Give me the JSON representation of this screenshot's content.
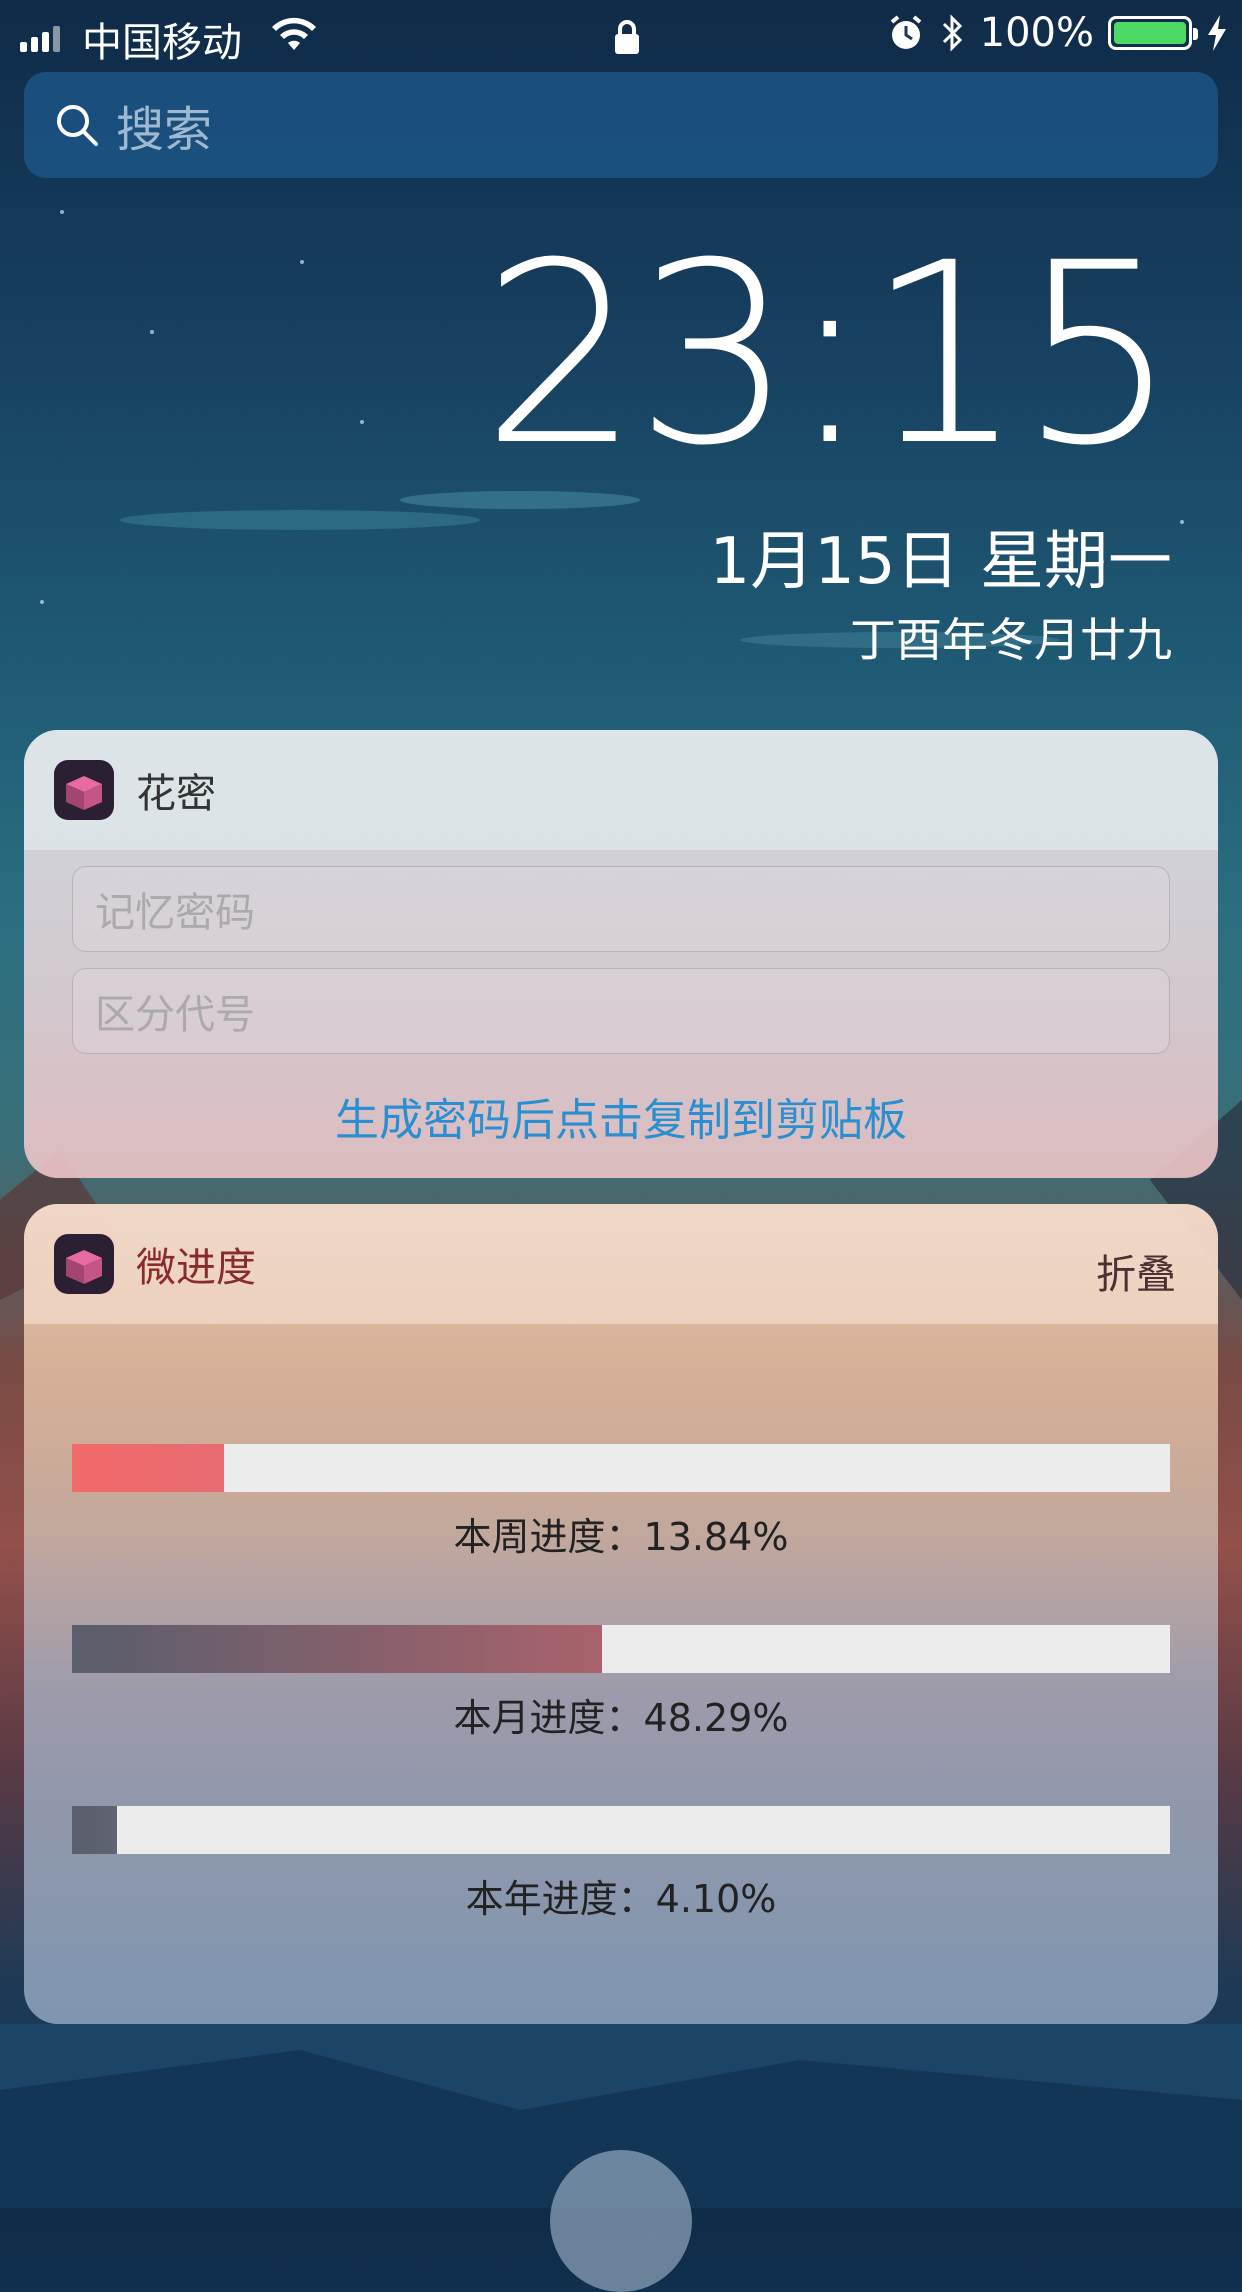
{
  "status_bar": {
    "carrier": "中国移动",
    "battery_percent": "100%",
    "battery_level": 1.0
  },
  "search": {
    "placeholder": "搜索"
  },
  "clock": {
    "time": "23:15",
    "date": "1月15日 星期一",
    "lunar": "丁酉年冬月廿九"
  },
  "widgets": [
    {
      "title": "花密",
      "fields": [
        {
          "placeholder": "记忆密码"
        },
        {
          "placeholder": "区分代号"
        }
      ],
      "hint": "生成密码后点击复制到剪贴板"
    },
    {
      "title": "微进度",
      "collapse_label": "折叠",
      "progress": [
        {
          "label": "本周进度：13.84%",
          "value": 13.84,
          "color_from": "#f26a6a",
          "color_to": "#e86b72"
        },
        {
          "label": "本月进度：48.29%",
          "value": 48.29,
          "color_from": "#5a5e6c",
          "color_to": "#a9626b"
        },
        {
          "label": "本年进度：4.10%",
          "value": 4.1,
          "color_from": "#5a5e6c",
          "color_to": "#5f6373"
        }
      ]
    }
  ],
  "colors": {
    "link": "#2a8fd0",
    "battery": "#4cd964"
  }
}
